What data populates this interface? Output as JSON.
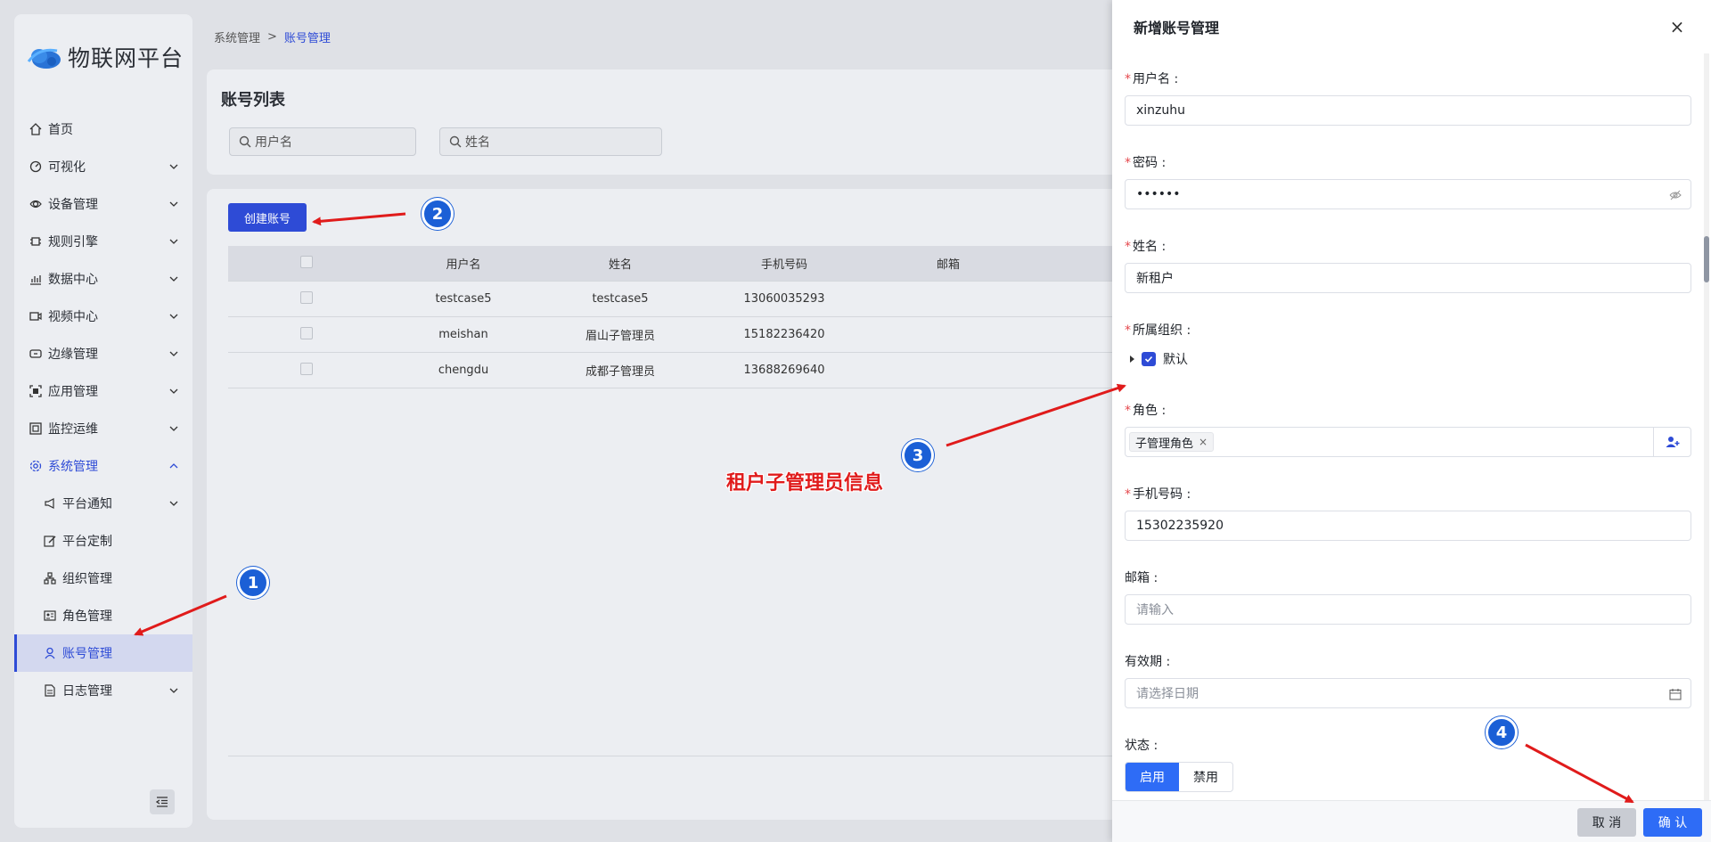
{
  "app": {
    "name": "物联网平台"
  },
  "sidebar": {
    "items": [
      {
        "label": "首页",
        "icon": "home-icon"
      },
      {
        "label": "可视化",
        "icon": "dashboard-icon"
      },
      {
        "label": "设备管理",
        "icon": "device-icon"
      },
      {
        "label": "规则引擎",
        "icon": "rule-icon"
      },
      {
        "label": "数据中心",
        "icon": "chart-icon"
      },
      {
        "label": "视频中心",
        "icon": "video-icon"
      },
      {
        "label": "边缘管理",
        "icon": "edge-icon"
      },
      {
        "label": "应用管理",
        "icon": "app-icon"
      },
      {
        "label": "监控运维",
        "icon": "monitor-icon"
      },
      {
        "label": "系统管理",
        "icon": "settings-icon"
      },
      {
        "label": "平台通知",
        "icon": "megaphone-icon"
      },
      {
        "label": "平台定制",
        "icon": "edit-icon"
      },
      {
        "label": "组织管理",
        "icon": "org-icon"
      },
      {
        "label": "角色管理",
        "icon": "role-card-icon"
      },
      {
        "label": "账号管理",
        "icon": "user-icon"
      },
      {
        "label": "日志管理",
        "icon": "log-icon"
      }
    ]
  },
  "breadcrumb": {
    "parent": "系统管理",
    "separator": ">",
    "current": "账号管理"
  },
  "list": {
    "title": "账号列表",
    "search_username_placeholder": "用户名",
    "search_name_placeholder": "姓名",
    "create_label": "创建账号",
    "columns": [
      "用户名",
      "姓名",
      "手机号码",
      "邮箱"
    ],
    "rows": [
      {
        "username": "testcase5",
        "name": "testcase5",
        "phone": "13060035293",
        "email": ""
      },
      {
        "username": "meishan",
        "name": "眉山子管理员",
        "phone": "15182236420",
        "email": ""
      },
      {
        "username": "chengdu",
        "name": "成都子管理员",
        "phone": "13688269640",
        "email": ""
      }
    ]
  },
  "drawer": {
    "title": "新增账号管理",
    "close": "×",
    "username_label": "用户名 :",
    "username_value": "xinzuhu",
    "password_label": "密码 :",
    "password_value": "••••••",
    "name_label": "姓名 :",
    "name_value": "新租户",
    "org_label": "所属组织 :",
    "org_value": "默认",
    "role_label": "角色 :",
    "role_tag": "子管理角色",
    "phone_label": "手机号码 :",
    "phone_value": "15302235920",
    "email_label": "邮箱 :",
    "email_placeholder": "请输入",
    "expiry_label": "有效期 :",
    "expiry_placeholder": "请选择日期",
    "status_label": "状态 :",
    "status_on": "启用",
    "status_off": "禁用",
    "cancel_label": "取 消",
    "ok_label": "确 认"
  },
  "annotations": {
    "badge1": "1",
    "badge2": "2",
    "badge3": "3",
    "badge4": "4",
    "note": "租户子管理员信息",
    "color": "#e01b1b"
  },
  "colors": {
    "primary": "#2e4bd6",
    "confirm": "#2e6cf6",
    "required": "#e5484d"
  }
}
